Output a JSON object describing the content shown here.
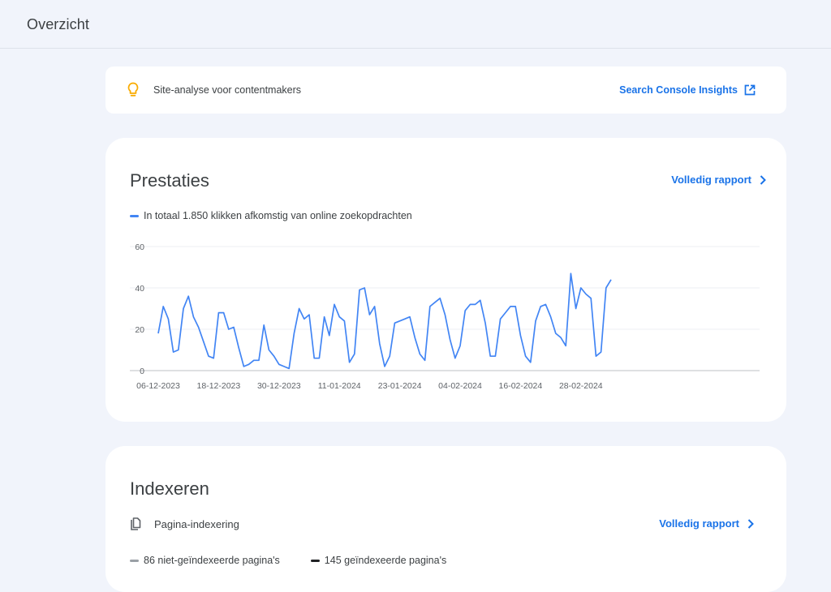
{
  "page": {
    "title": "Overzicht"
  },
  "insights": {
    "text": "Site-analyse voor contentmakers",
    "link_label": "Search Console Insights"
  },
  "performance": {
    "title": "Prestaties",
    "report_link": "Volledig rapport",
    "legend": "In totaal 1.850 klikken afkomstig van online zoekopdrachten",
    "series_color": "#4285f4"
  },
  "chart_data": {
    "type": "line",
    "title": "",
    "xlabel": "",
    "ylabel": "",
    "ylim": [
      0,
      60
    ],
    "yticks": [
      0,
      20,
      40,
      60
    ],
    "xtick_labels": [
      "06-12-2023",
      "18-12-2023",
      "30-12-2023",
      "11-01-2024",
      "23-01-2024",
      "04-02-2024",
      "16-02-2024",
      "28-02-2024"
    ],
    "grid": true,
    "start_date": "06-12-2023",
    "series": [
      {
        "values": [
          18,
          31,
          25,
          9,
          10,
          30,
          36,
          26,
          21,
          14,
          7,
          6,
          28,
          28,
          20,
          21,
          11,
          2,
          3,
          5,
          5,
          22,
          10,
          7,
          3,
          2,
          1,
          18,
          30,
          25,
          27,
          6,
          6,
          26,
          17,
          32,
          26,
          24,
          4,
          8,
          39,
          40,
          27,
          31,
          13,
          2,
          7,
          23,
          24,
          25,
          26,
          16,
          8,
          5,
          31,
          33,
          35,
          27,
          15,
          6,
          12,
          29,
          32,
          32,
          34,
          23,
          7,
          7,
          25,
          28,
          31,
          31,
          17,
          7,
          4,
          24,
          31,
          32,
          26,
          18,
          16,
          12,
          47,
          30,
          40,
          37,
          35,
          7,
          9,
          40,
          44
        ]
      }
    ]
  },
  "indexing": {
    "title": "Indexeren",
    "sub_label": "Pagina-indexering",
    "report_link": "Volledig rapport",
    "legend": [
      {
        "label": "86 niet-geïndexeerde pagina's",
        "color": "#9aa0a6"
      },
      {
        "label": "145 geïndexeerde pagina's",
        "color": "#202124"
      }
    ]
  }
}
